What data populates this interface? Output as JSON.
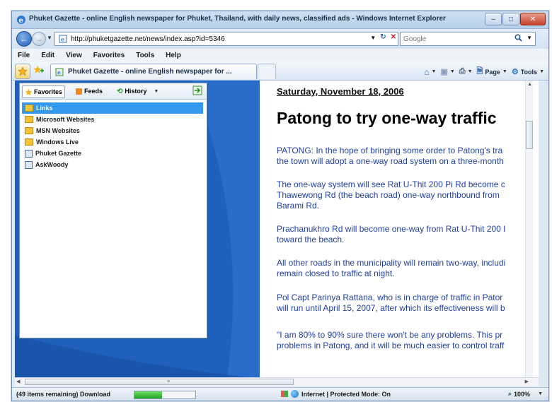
{
  "window": {
    "title": "Phuket Gazette - online English newspaper for Phuket, Thailand, with daily news, classified ads - Windows Internet Explorer"
  },
  "address": {
    "url": "http://phuketgazette.net/news/index.asp?id=5346"
  },
  "search": {
    "placeholder": "Google"
  },
  "menu": {
    "items": [
      "File",
      "Edit",
      "View",
      "Favorites",
      "Tools",
      "Help"
    ]
  },
  "tab": {
    "label": "Phuket Gazette - online English newspaper for ..."
  },
  "commandbar": {
    "page_label": "Page",
    "tools_label": "Tools"
  },
  "favorites": {
    "tabs": [
      "Favorites",
      "Feeds",
      "History"
    ],
    "items": [
      "Links",
      "Microsoft Websites",
      "MSN Websites",
      "Windows Live",
      "Phuket Gazette",
      "AskWoody"
    ],
    "selected_index": 0
  },
  "article": {
    "date": "Saturday, November 18, 2006",
    "headline": "Patong to try one-way traffic",
    "paragraphs": [
      [
        "PATONG: In the hope of bringing some order to Patong's tra",
        "the town will adopt a one-way road system on a three-month"
      ],
      [
        "The one-way system will see Rat U-Thit 200 Pi Rd become c",
        "Thawewong Rd (the beach road) one-way northbound from",
        "Barami Rd."
      ],
      [
        "Prachanukhro Rd will become one-way from Rat U-Thit 200 I",
        "toward the beach."
      ],
      [
        "All other roads in the municipality will remain two-way, includi",
        "remain closed to traffic at night."
      ],
      [
        "Pol Capt Parinya Rattana, who is in charge of traffic in Pator",
        "will run until April 15, 2007, after which its effectiveness will b"
      ],
      [
        "\"I am 80% to 90% sure there won't be any problems. This pr",
        "problems in Patong, and it will be much easier to control traff"
      ]
    ]
  },
  "status": {
    "text": "(49 items remaining) Download",
    "progress": 0.45,
    "zone": "Internet | Protected Mode: On",
    "zoom": "100%"
  },
  "colors": {
    "selection": "#3399ee",
    "panel_blue": "#1f5fb8"
  }
}
